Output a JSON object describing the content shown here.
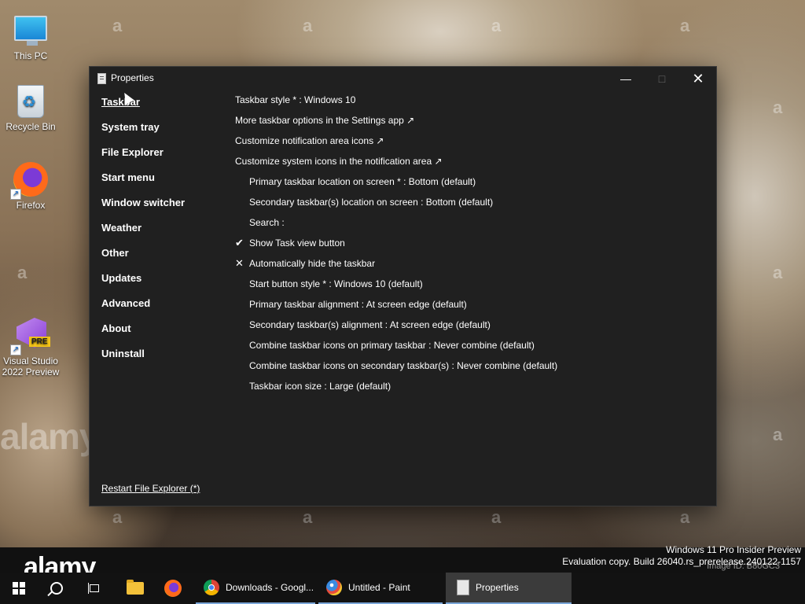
{
  "desktop": {
    "icons": [
      {
        "label": "This PC"
      },
      {
        "label": "Recycle Bin"
      },
      {
        "label": "Firefox"
      },
      {
        "label": "Visual Studio 2022 Preview",
        "badge": "PRE"
      }
    ],
    "watermark": "alamy",
    "watermark_letter": "a",
    "eval_line1": "Windows 11 Pro Insider Preview",
    "eval_line2": "Evaluation copy. Build 26040.rs_prerelease.240122-1157",
    "image_id": "Image ID: B80GC3"
  },
  "window": {
    "title": "Properties",
    "nav": [
      {
        "label": "Taskbar",
        "active": true
      },
      {
        "label": "System tray"
      },
      {
        "label": "File Explorer"
      },
      {
        "label": "Start menu"
      },
      {
        "label": "Window switcher"
      },
      {
        "label": "Weather"
      },
      {
        "label": "Other"
      },
      {
        "label": "Updates"
      },
      {
        "label": "Advanced"
      },
      {
        "label": "About"
      },
      {
        "label": "Uninstall"
      }
    ],
    "restart_link": "Restart File Explorer (*)",
    "settings": [
      {
        "label": "Taskbar style * : Windows 10",
        "indent": false,
        "mark": ""
      },
      {
        "label": "More taskbar options in the Settings app ↗",
        "indent": false,
        "mark": ""
      },
      {
        "label": "Customize notification area icons ↗",
        "indent": false,
        "mark": ""
      },
      {
        "label": "Customize system icons in the notification area ↗",
        "indent": false,
        "mark": ""
      },
      {
        "label": "Primary taskbar location on screen * : Bottom (default)",
        "indent": true,
        "mark": ""
      },
      {
        "label": "Secondary taskbar(s) location on screen : Bottom (default)",
        "indent": true,
        "mark": ""
      },
      {
        "label": "Search :",
        "indent": true,
        "mark": ""
      },
      {
        "label": "Show Task view button",
        "indent": true,
        "mark": "✔"
      },
      {
        "label": "Automatically hide the taskbar",
        "indent": true,
        "mark": "✕"
      },
      {
        "label": "Start button style * : Windows 10 (default)",
        "indent": true,
        "mark": ""
      },
      {
        "label": "Primary taskbar alignment : At screen edge (default)",
        "indent": true,
        "mark": ""
      },
      {
        "label": "Secondary taskbar(s) alignment : At screen edge (default)",
        "indent": true,
        "mark": ""
      },
      {
        "label": "Combine taskbar icons on primary taskbar : Never combine (default)",
        "indent": true,
        "mark": ""
      },
      {
        "label": "Combine taskbar icons on secondary taskbar(s) : Never combine (default)",
        "indent": true,
        "mark": ""
      },
      {
        "label": "Taskbar icon size : Large (default)",
        "indent": true,
        "mark": ""
      }
    ]
  },
  "taskbar": {
    "apps": [
      {
        "label": "Downloads - Googl...",
        "icon": "chrome-icon"
      },
      {
        "label": "Untitled - Paint",
        "icon": "paint-icon"
      },
      {
        "label": "Properties",
        "icon": "properties-icon"
      }
    ]
  },
  "colors": {
    "window_bg": "#202020",
    "taskbar_bg": "#121212",
    "running_indicator": "#7aa6d8"
  }
}
